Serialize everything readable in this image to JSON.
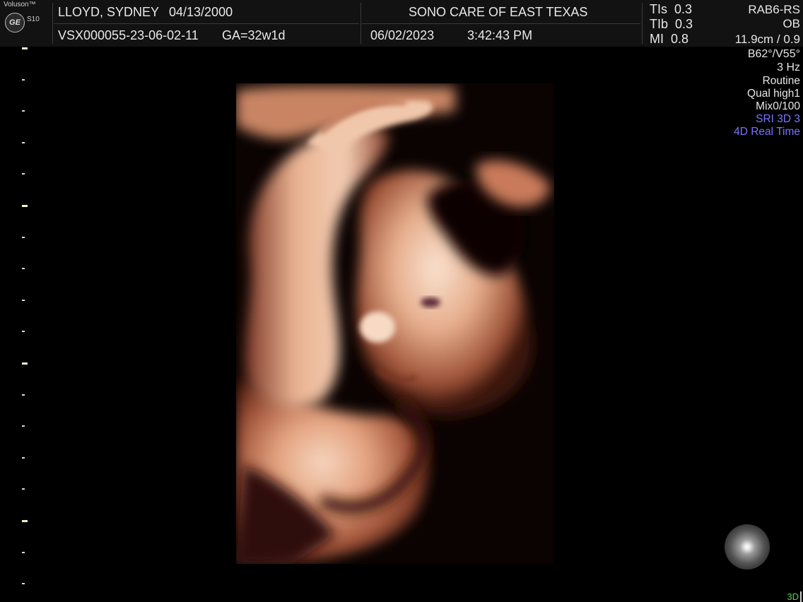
{
  "header": {
    "brand": "Voluson™",
    "logo": "GE",
    "model": "S10",
    "patient_name": "LLOYD, SYDNEY",
    "patient_dob": "04/13/2000",
    "exam_id": "VSX000055-23-06-02-11",
    "gestational_age": "GA=32w1d",
    "clinic": "SONO CARE OF EAST TEXAS",
    "date": "06/02/2023",
    "time": "3:42:43 PM",
    "tis": "TIs  0.3",
    "tib": "TIb  0.3",
    "mi": "MI  0.8",
    "probe": "RAB6-RS",
    "preset": "OB",
    "depth_scale": "11.9cm / 0.9"
  },
  "params": {
    "angles": "B62°/V55°",
    "frame_rate": "3 Hz",
    "mode": "Routine",
    "quality": "Qual high1",
    "mix": "Mix0/100",
    "sri": "SRI 3D 3",
    "realtime": "4D Real Time"
  },
  "colors": {
    "sri": "#7b74ff",
    "realtime": "#7b74ff",
    "tag_3d": "#4fd34f"
  },
  "footer": {
    "mode_tag": "3D"
  },
  "icons": [
    "ge-logo-icon",
    "render-light-orb-icon"
  ]
}
